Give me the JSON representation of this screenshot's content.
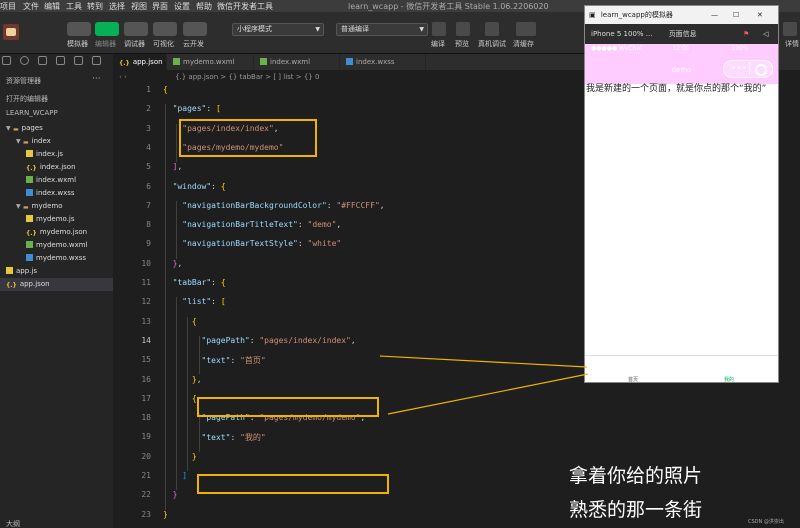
{
  "menubar": {
    "items": [
      "项目",
      "文件",
      "编辑",
      "工具",
      "转到",
      "选择",
      "视图",
      "界面",
      "设置",
      "帮助",
      "微信开发者工具"
    ],
    "window_title": "learn_wcapp - 微信开发者工具 Stable 1.06.2206020"
  },
  "toolbar": {
    "avatar": "avatar",
    "left_buttons": [
      "模拟器",
      "编辑器",
      "调试器",
      "可视化",
      "云开发"
    ],
    "mode_select": "小程序模式",
    "compile_select": "普通编译",
    "right_buttons": [
      "编译",
      "预览",
      "真机调试",
      "清缓存"
    ],
    "far_right": "详情"
  },
  "sidebar": {
    "title": "资源管理器",
    "more": "···",
    "open_editors": "打开的编辑器",
    "project": "LEARN_WCAPP",
    "tree": [
      {
        "label": "pages",
        "type": "folder",
        "indent": 0
      },
      {
        "label": "index",
        "type": "folder",
        "indent": 1
      },
      {
        "label": "index.js",
        "type": "js",
        "indent": 2
      },
      {
        "label": "index.json",
        "type": "json",
        "indent": 2
      },
      {
        "label": "index.wxml",
        "type": "wxml",
        "indent": 2
      },
      {
        "label": "index.wxss",
        "type": "wxss",
        "indent": 2
      },
      {
        "label": "mydemo",
        "type": "folder",
        "indent": 1
      },
      {
        "label": "mydemo.js",
        "type": "js",
        "indent": 2
      },
      {
        "label": "mydemo.json",
        "type": "json",
        "indent": 2
      },
      {
        "label": "mydemo.wxml",
        "type": "wxml",
        "indent": 2
      },
      {
        "label": "mydemo.wxss",
        "type": "wxss",
        "indent": 2
      },
      {
        "label": "app.js",
        "type": "js",
        "indent": 0
      },
      {
        "label": "app.json",
        "type": "json",
        "indent": 0
      }
    ],
    "outline": "大纲"
  },
  "tabs": [
    {
      "label": "app.json",
      "type": "json",
      "active": true
    },
    {
      "label": "mydemo.wxml",
      "type": "wxml",
      "active": false
    },
    {
      "label": "index.wxml",
      "type": "wxml",
      "active": false
    },
    {
      "label": "index.wxss",
      "type": "wxss",
      "active": false
    }
  ],
  "breadcrumb": "{.} app.json > {} tabBar > [ ] list > {} 0",
  "editor": {
    "current_line": 14,
    "lines": [
      {
        "n": 1,
        "t": "{"
      },
      {
        "n": 2,
        "t": "  \"pages\": ["
      },
      {
        "n": 3,
        "t": "    \"pages/index/index\","
      },
      {
        "n": 4,
        "t": "    \"pages/mydemo/mydemo\""
      },
      {
        "n": 5,
        "t": "  ],"
      },
      {
        "n": 6,
        "t": "  \"window\": {"
      },
      {
        "n": 7,
        "t": "    \"navigationBarBackgroundColor\": \"#FFCCFF\","
      },
      {
        "n": 8,
        "t": "    \"navigationBarTitleText\": \"demo\","
      },
      {
        "n": 9,
        "t": "    \"navigationBarTextStyle\": \"white\""
      },
      {
        "n": 10,
        "t": "  },"
      },
      {
        "n": 11,
        "t": "  \"tabBar\": {"
      },
      {
        "n": 12,
        "t": "    \"list\": ["
      },
      {
        "n": 13,
        "t": "      {"
      },
      {
        "n": 14,
        "t": "        \"pagePath\": \"pages/index/index\","
      },
      {
        "n": 15,
        "t": "        \"text\": \"首页\""
      },
      {
        "n": 16,
        "t": "      },"
      },
      {
        "n": 17,
        "t": "      {"
      },
      {
        "n": 18,
        "t": "        \"pagePath\": \"pages/mydemo/mydemo\","
      },
      {
        "n": 19,
        "t": "        \"text\": \"我的\""
      },
      {
        "n": 20,
        "t": "      }"
      },
      {
        "n": 21,
        "t": "    ]"
      },
      {
        "n": 22,
        "t": "  }"
      },
      {
        "n": 23,
        "t": "}"
      }
    ]
  },
  "simulator": {
    "title": "learn_wcapp的模拟器",
    "device": "iPhone 5 100% ...",
    "page_info": "页面信息",
    "status_left": "●●●●● WeChat",
    "status_time": "12:00",
    "status_right": "100%",
    "nav_title": "demo",
    "nav_color": "#FFCCFF",
    "content": "我是新建的一个页面，就是你点的那个“我的”",
    "tabbar": [
      {
        "label": "首页",
        "color": "#555555"
      },
      {
        "label": "我的",
        "color": "#06b054"
      }
    ]
  },
  "overlay": {
    "line1": "拿着你给的照片",
    "line2": "熟悉的那一条街",
    "watermark": "CSDN @洪崇出"
  },
  "colors": {
    "highlight": "#f0b400",
    "string": "#ce9178",
    "key": "#9cdcfe",
    "accent_green": "#06b054"
  }
}
